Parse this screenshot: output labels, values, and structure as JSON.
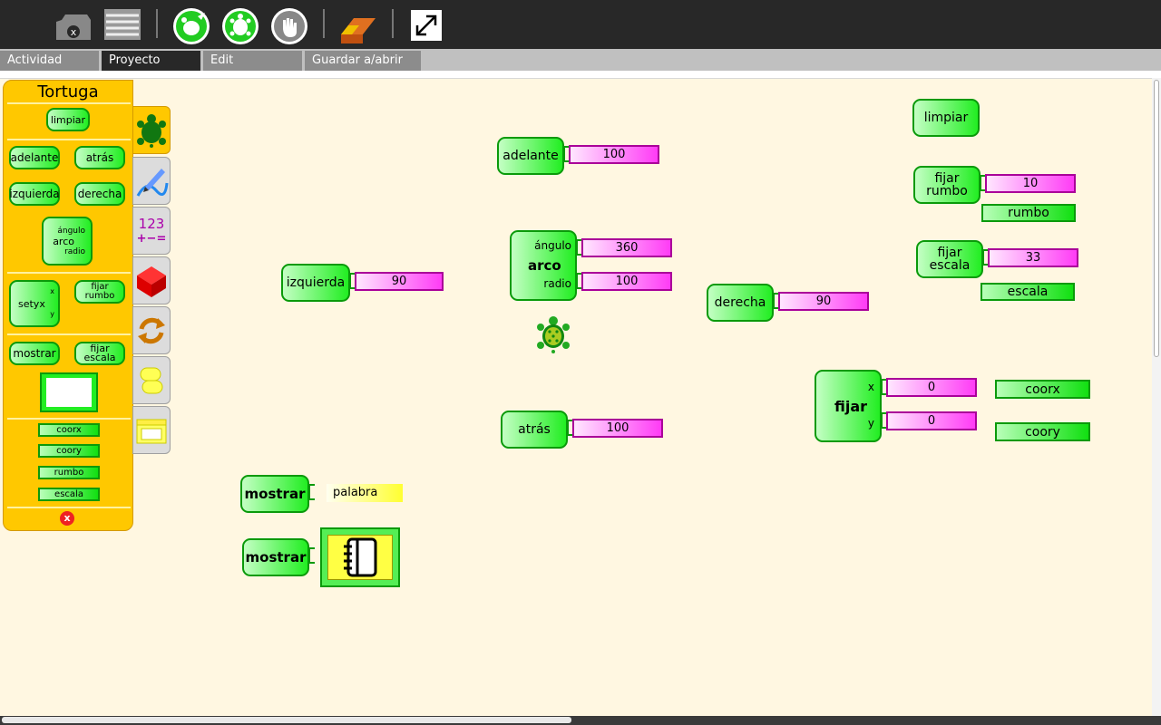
{
  "toolbar": {
    "icons": [
      "activity-icon",
      "paste-icon",
      "run-fast-icon",
      "run-slow-icon",
      "stop-icon",
      "clear-eraser-icon",
      "fullscreen-icon"
    ]
  },
  "tabs": [
    {
      "label": "Actividad"
    },
    {
      "label": "Proyecto"
    },
    {
      "label": "Edit"
    },
    {
      "label": "Guardar a/abrir de"
    }
  ],
  "palette": {
    "title": "Tortuga",
    "blocks": {
      "clear": "limpiar",
      "forward": "adelante",
      "back": "atrás",
      "left": "izquierda",
      "right": "derecha",
      "arc_angle": "ángulo",
      "arc": "arco",
      "arc_radius": "radio",
      "setxy": "setyx",
      "setxy_x": "x",
      "setxy_y": "y",
      "setheading": "fijar rumbo",
      "show": "mostrar",
      "setscale": "fijar escala",
      "xcor": "coorx",
      "ycor": "coory",
      "heading": "rumbo",
      "scale": "escala"
    },
    "close_label": "x"
  },
  "side_tabs": [
    "turtle-palette-icon",
    "pen-palette-icon",
    "numbers-palette-icon",
    "blocks-palette-icon",
    "flow-palette-icon",
    "boxes-palette-icon",
    "media-palette-icon"
  ],
  "numbers_tab": {
    "top": "123",
    "bottom": "+−="
  },
  "canvas": {
    "left_block": {
      "label": "izquierda",
      "value": "90"
    },
    "forward_block": {
      "label": "adelante",
      "value": "100"
    },
    "arc_block": {
      "label": "arco",
      "angle_label": "ángulo",
      "radius_label": "radio",
      "angle": "360",
      "radius": "100"
    },
    "back_block": {
      "label": "atrás",
      "value": "100"
    },
    "right_block": {
      "label": "derecha",
      "value": "90"
    },
    "clear_block": {
      "label": "limpiar"
    },
    "heading_block": {
      "label": "fijar rumbo",
      "value": "10",
      "reporter": "rumbo"
    },
    "scale_block": {
      "label": "fijar escala",
      "value": "33",
      "reporter": "escala"
    },
    "setxy_block": {
      "label": "fijar",
      "x_label": "x",
      "y_label": "y",
      "x": "0",
      "y": "0"
    },
    "xcor_reporter": "coorx",
    "ycor_reporter": "coory",
    "show_text_block": {
      "label": "mostrar",
      "value": "palabra"
    },
    "show_media_block": {
      "label": "mostrar"
    }
  },
  "colors": {
    "toolbar": "#282828",
    "canvas": "#fff7e1",
    "palette": "#ffc800",
    "turtle_block": "#22ee22",
    "number_block": "#ff3cf6",
    "string_block": "#ffff40"
  }
}
